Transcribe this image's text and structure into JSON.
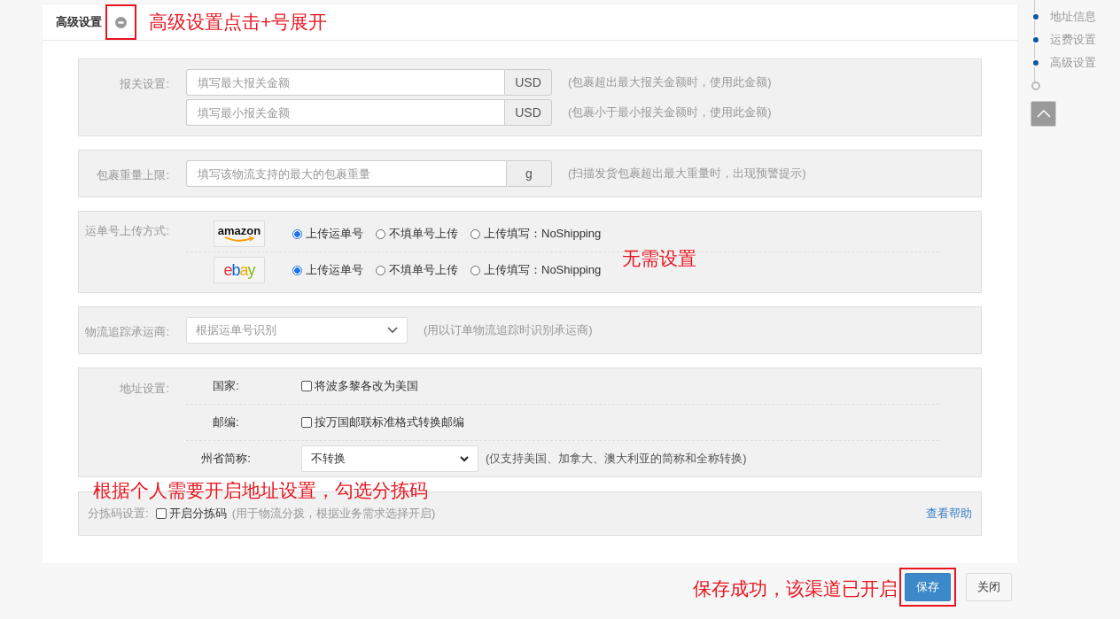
{
  "section": {
    "title": "高级设置",
    "expanded": true,
    "toggle_highlighted": true
  },
  "customs": {
    "label": "报关设置:",
    "fields": [
      {
        "placeholder": "填写最大报关金额",
        "unit": "USD",
        "hint": "(包裹超出最大报关金额时，使用此金额)"
      },
      {
        "placeholder": "填写最小报关金额",
        "unit": "USD",
        "hint": "(包裹小于最小报关金额时，使用此金额)"
      }
    ]
  },
  "weight": {
    "label": "包裹重量上限:",
    "placeholder": "填写该物流支持的最大的包裹重量",
    "unit": "g",
    "hint": "(扫描发货包裹超出最大重量时，出现预警提示)"
  },
  "upload": {
    "label": "运单号上传方式:",
    "platforms": [
      {
        "kind": "amazon",
        "logo": "amazon",
        "options": [
          {
            "label": "上传运单号",
            "selected": true
          },
          {
            "label": "不填单号上传",
            "selected": false
          },
          {
            "label": "上传填写：NoShipping",
            "selected": false
          }
        ]
      },
      {
        "kind": "ebay",
        "logo": "ebay",
        "options": [
          {
            "label": "上传运单号",
            "selected": true
          },
          {
            "label": "不填单号上传",
            "selected": false
          },
          {
            "label": "上传填写：NoShipping",
            "selected": false
          }
        ]
      }
    ]
  },
  "carrier": {
    "label": "物流追踪承运商:",
    "value": "根据运单号识别",
    "hint": "(用以订单物流追踪时识别承运商)"
  },
  "address": {
    "label": "地址设置:",
    "rows": [
      {
        "kind": "checkbox",
        "label": "国家:",
        "option": "将波多黎各改为美国",
        "checked": false
      },
      {
        "kind": "checkbox",
        "label": "邮编:",
        "option": "按万国邮联标准格式转换邮编",
        "checked": false
      },
      {
        "kind": "select",
        "label": "州省简称:",
        "value": "不转换",
        "hint": "(仅支持美国、加拿大、澳大利亚的简称和全称转换)"
      }
    ]
  },
  "sorting": {
    "label": "分拣码设置:",
    "option": "开启分拣码",
    "checked": false,
    "hint": "(用于物流分拨，根据业务需求选择开启)",
    "help_link": "查看帮助"
  },
  "buttons": [
    {
      "kind": "primary",
      "label": "保存",
      "highlighted": true
    },
    {
      "kind": "default",
      "label": "关闭",
      "highlighted": false
    }
  ],
  "nav": [
    {
      "label": "地址信息",
      "done": true
    },
    {
      "label": "运费设置",
      "done": true
    },
    {
      "label": "高级设置",
      "done": true
    },
    {
      "done": false
    }
  ],
  "notes": {
    "header": "高级设置点击+号展开",
    "upload": "无需设置",
    "address": "根据个人需要开启地址设置，勾选分拣码",
    "save": "保存成功，该渠道已开启"
  }
}
